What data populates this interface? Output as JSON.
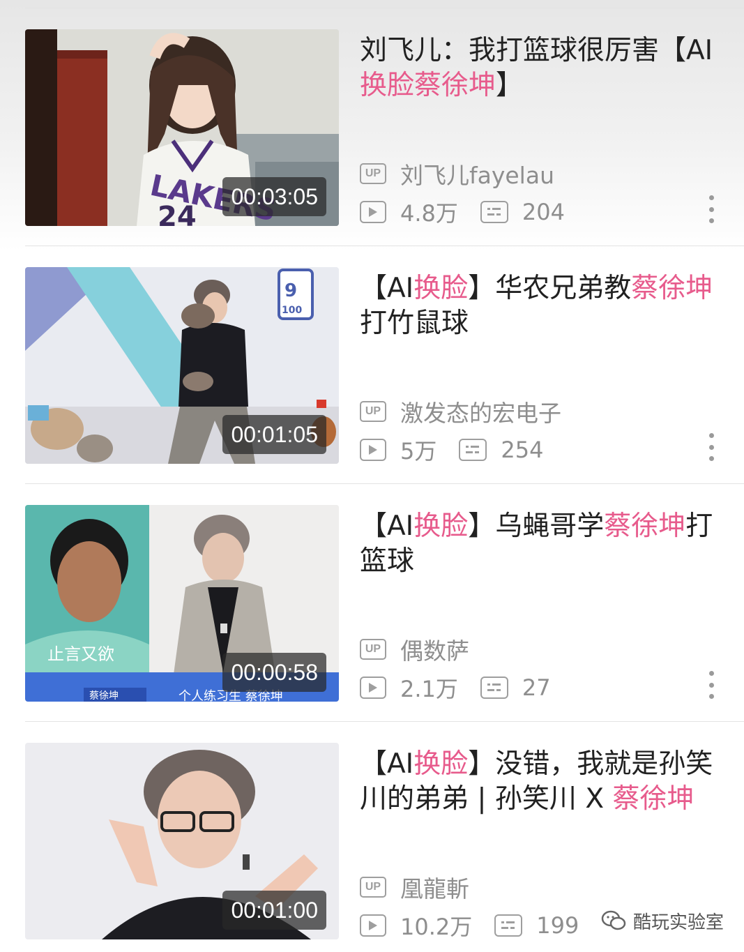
{
  "videos": [
    {
      "title_parts": [
        "刘飞儿：我打篮球很厉害【AI",
        "换脸蔡徐坤",
        "】"
      ],
      "duration": "00:03:05",
      "uploader": "刘飞儿fayelau",
      "views": "4.8万",
      "comments": "204",
      "thumb_text": "LAKERS"
    },
    {
      "title_parts": [
        "【AI",
        "换脸",
        "】华农兄弟教",
        "蔡徐坤",
        "打竹鼠球"
      ],
      "duration": "00:01:05",
      "uploader": "激发态的宏电子",
      "views": "5万",
      "comments": "254",
      "thumb_text": "100"
    },
    {
      "title_parts": [
        "【AI",
        "换脸",
        "】乌蝇哥学",
        "蔡徐坤",
        "打篮球"
      ],
      "duration": "00:00:58",
      "uploader": "偶数萨",
      "views": "2.1万",
      "comments": "27",
      "thumb_caption": "止言又欲",
      "thumb_name_tag": "蔡徐坤",
      "thumb_bottom_text": "个人练习生 蔡徐坤"
    },
    {
      "title_parts": [
        "【AI",
        "换脸",
        "】没错，我就是孙笑川的弟弟 | 孙笑川 X ",
        "蔡徐坤"
      ],
      "duration": "00:01:00",
      "uploader": "凰龍斬",
      "views": "10.2万",
      "comments": "199"
    }
  ],
  "up_badge": "UP",
  "watermark": "酷玩实验室",
  "highlight_color": "#e75b8c"
}
